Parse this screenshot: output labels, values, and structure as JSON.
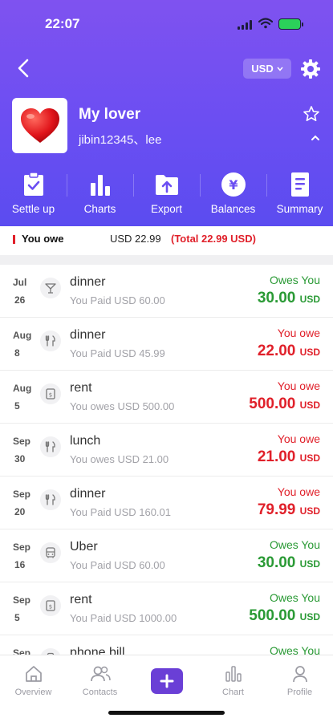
{
  "status_bar": {
    "time": "22:07"
  },
  "header": {
    "currency": "USD",
    "group_name": "My lover",
    "members": "jibin12345、lee"
  },
  "actions": [
    {
      "label": "Settle up",
      "icon": "clipboard-check-icon"
    },
    {
      "label": "Charts",
      "icon": "bar-chart-icon"
    },
    {
      "label": "Export",
      "icon": "folder-upload-icon"
    },
    {
      "label": "Balances",
      "icon": "yen-coin-icon"
    },
    {
      "label": "Summary",
      "icon": "document-icon"
    }
  ],
  "summary": {
    "label": "You owe",
    "amount": "USD 22.99",
    "total": "(Total 22.99 USD)"
  },
  "transactions": [
    {
      "month": "Jul",
      "day": "26",
      "title": "dinner",
      "detail": "You Paid USD 60.00",
      "status": "Owes You",
      "amount": "30.00",
      "currency": "USD",
      "icon": "cocktail-icon"
    },
    {
      "month": "Aug",
      "day": "8",
      "title": "dinner",
      "detail": "You Paid USD 45.99",
      "status": "You owe",
      "amount": "22.00",
      "currency": "USD",
      "icon": "cutlery-icon"
    },
    {
      "month": "Aug",
      "day": "5",
      "title": "rent",
      "detail": "You owes USD 500.00",
      "status": "You owe",
      "amount": "500.00",
      "currency": "USD",
      "icon": "receipt-icon"
    },
    {
      "month": "Sep",
      "day": "30",
      "title": "lunch",
      "detail": "You owes USD 21.00",
      "status": "You owe",
      "amount": "21.00",
      "currency": "USD",
      "icon": "cutlery-icon"
    },
    {
      "month": "Sep",
      "day": "20",
      "title": "dinner",
      "detail": "You Paid USD 160.01",
      "status": "You owe",
      "amount": "79.99",
      "currency": "USD",
      "icon": "cutlery-icon"
    },
    {
      "month": "Sep",
      "day": "16",
      "title": "Uber",
      "detail": "You Paid USD 60.00",
      "status": "Owes You",
      "amount": "30.00",
      "currency": "USD",
      "icon": "bus-icon"
    },
    {
      "month": "Sep",
      "day": "5",
      "title": "rent",
      "detail": "You Paid USD 1000.00",
      "status": "Owes You",
      "amount": "500.00",
      "currency": "USD",
      "icon": "receipt-icon"
    },
    {
      "month": "Sep",
      "day": "",
      "title": "phone bill",
      "detail": "",
      "status": "Owes You",
      "amount": "",
      "currency": "",
      "icon": "phone-icon"
    }
  ],
  "tabbar": [
    {
      "label": "Overview",
      "icon": "home-icon"
    },
    {
      "label": "Contacts",
      "icon": "contacts-icon"
    },
    {
      "label": "",
      "icon": "plus-icon"
    },
    {
      "label": "Chart",
      "icon": "chart-icon"
    },
    {
      "label": "Profile",
      "icon": "profile-icon"
    }
  ],
  "colors": {
    "header": "#6b4ef2",
    "owes_you": "#2a9a35",
    "you_owe": "#e0202a",
    "add_button": "#6a3fd6"
  }
}
